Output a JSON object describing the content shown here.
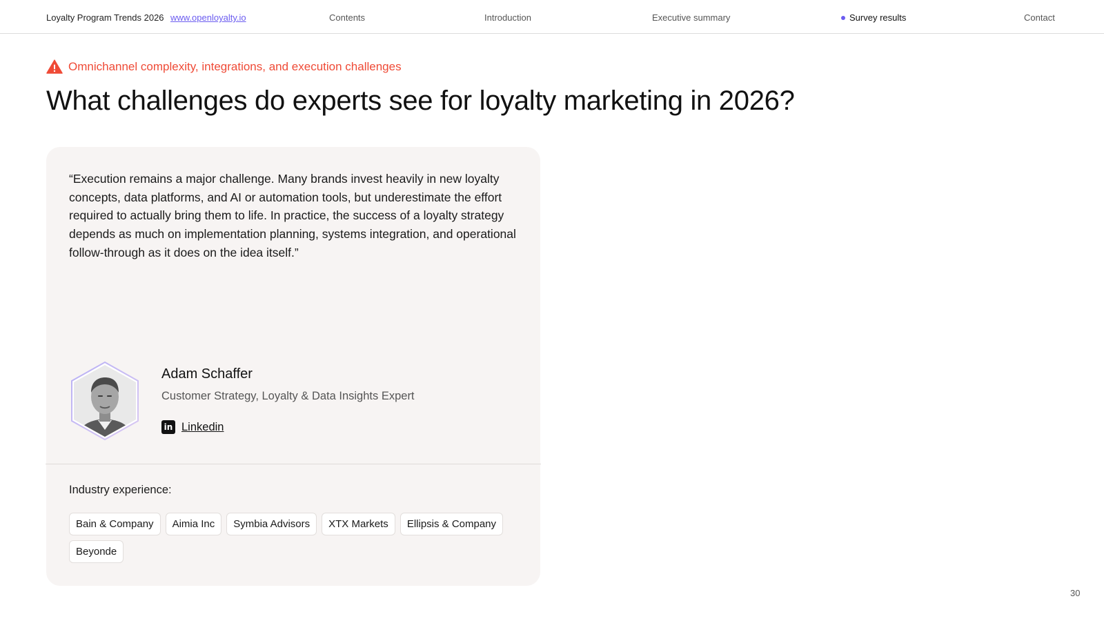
{
  "header": {
    "brand": "Loyalty Program Trends 2026",
    "site_link": "www.openloyalty.io",
    "nav": {
      "contents": "Contents",
      "introduction": "Introduction",
      "executive_summary": "Executive summary",
      "survey_results": "Survey results",
      "contact": "Contact"
    },
    "active_item": "survey_results",
    "accent_color": "#6b5cf0"
  },
  "section": {
    "icon": "warning-icon",
    "label": "Omnichannel complexity, integrations, and execution challenges",
    "color": "#ef4a36"
  },
  "title": "What challenges do experts see for loyalty marketing in 2026?",
  "card": {
    "quote": "“Execution remains a major challenge. Many brands invest heavily in new loyalty concepts, data platforms, and AI or automation tools, but underestimate the effort required to actually bring them to life. In practice, the success of a loyalty strategy depends as much on implementation planning, systems integration, and operational follow-through as it does on the idea itself.”",
    "person": {
      "name": "Adam Schaffer",
      "role": "Customer Strategy, Loyalty & Data Insights Expert",
      "link_label": "Linkedin",
      "link_icon": "linkedin-icon"
    },
    "industry_label": "Industry experience:",
    "companies": [
      "Bain & Company",
      "Aimia Inc",
      "Symbia Advisors",
      "XTX Markets",
      "Ellipsis & Company",
      "Beyonde"
    ]
  },
  "page_number": "30"
}
